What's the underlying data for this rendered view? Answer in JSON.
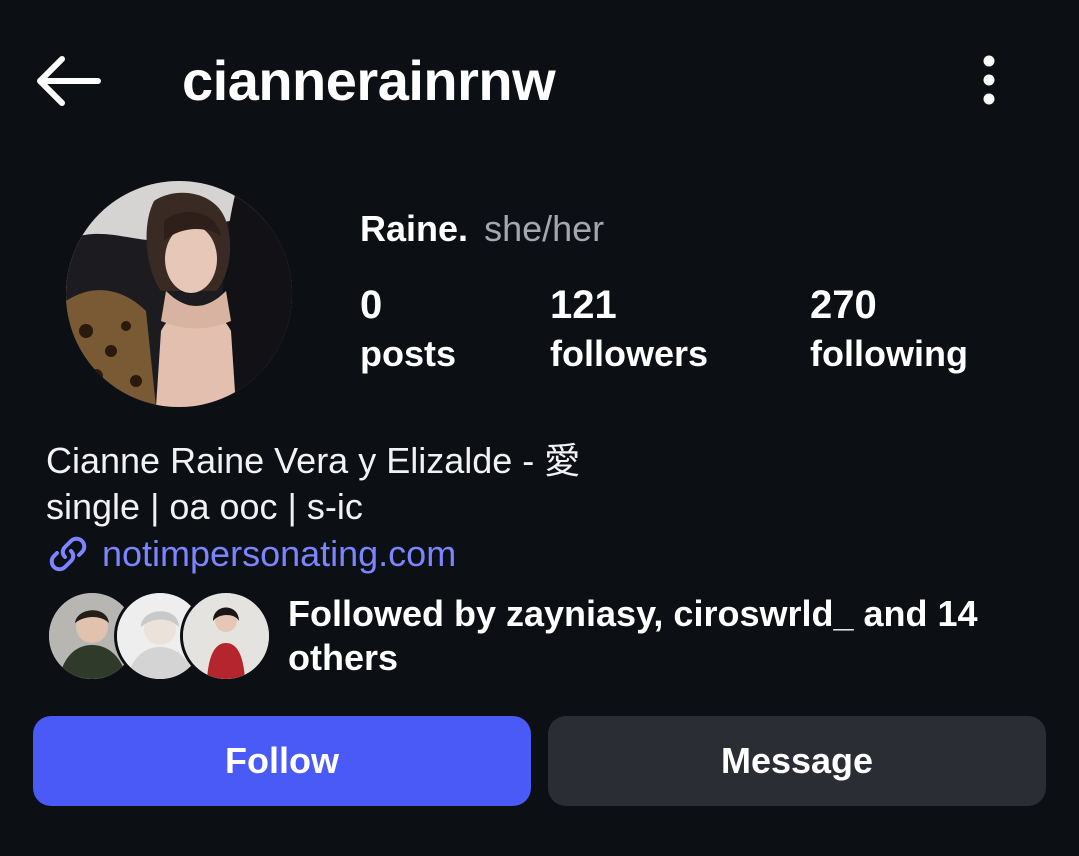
{
  "header": {
    "username": "cianneraïnrnw",
    "back_icon": "arrow-left-icon",
    "more_icon": "more-vertical-icon"
  },
  "profile": {
    "display_name": "Raine.",
    "pronouns": "she/her",
    "avatar": "profile-photo"
  },
  "stats": {
    "posts": {
      "count": "0",
      "label": "posts"
    },
    "followers": {
      "count": "121",
      "label": "followers"
    },
    "following": {
      "count": "270",
      "label": "following"
    }
  },
  "bio": {
    "line1": "Cianne Raine Vera y Elizalde - 愛",
    "line2": "single | oa ooc | s-ic",
    "link": "notimpersonating.com",
    "link_icon": "link-icon"
  },
  "mutuals": {
    "text": "Followed by zayniasy, ciroswrld_ and 14 others",
    "avatars": [
      "mutual-avatar-1",
      "mutual-avatar-2",
      "mutual-avatar-3"
    ]
  },
  "actions": {
    "follow_label": "Follow",
    "message_label": "Message"
  },
  "colors": {
    "background": "#0c0f14",
    "accent": "#4a5af7",
    "secondary_button": "#2a2d33",
    "link": "#7b85ff",
    "muted_text": "#a4a7ae"
  }
}
